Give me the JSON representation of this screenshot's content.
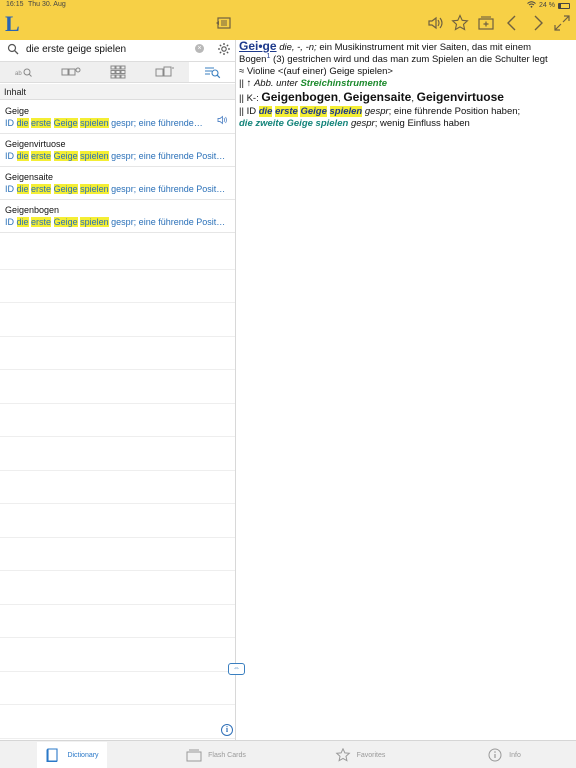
{
  "status": {
    "time": "16:15",
    "date": "Thu 30. Aug",
    "battery": "24 %",
    "battery_level": 0.24
  },
  "app": {
    "logo": "L"
  },
  "toolbar": {
    "icons": [
      "history-icon",
      "speaker-icon",
      "star-icon",
      "add-flashcard-icon",
      "back-icon",
      "forward-icon",
      "fullscreen-icon"
    ]
  },
  "search": {
    "value": "die erste geige spielen",
    "placeholder": ""
  },
  "modes": [
    "fulltext-search-icon",
    "compound-search-icon",
    "grid-icon",
    "wildcard-search-icon",
    "content-search-icon"
  ],
  "section": {
    "title": "Inhalt"
  },
  "results": [
    {
      "title": "Geige",
      "prefix": "ID",
      "hl": [
        "die",
        "erste",
        "Geige",
        "spielen"
      ],
      "rest": "gespr; eine führende…"
    },
    {
      "title": "Geigenvirtuose",
      "prefix": "ID",
      "hl": [
        "die",
        "erste",
        "Geige",
        "spielen"
      ],
      "rest": "gespr; eine führende Posit…"
    },
    {
      "title": "Geigensaite",
      "prefix": "ID",
      "hl": [
        "die",
        "erste",
        "Geige",
        "spielen"
      ],
      "rest": "gespr; eine führende Posit…"
    },
    {
      "title": "Geigenbogen",
      "prefix": "ID",
      "hl": [
        "die",
        "erste",
        "Geige",
        "spielen"
      ],
      "rest": "gespr; eine führende Posit…"
    }
  ],
  "entry": {
    "headword": "Gei•ge",
    "grammar": "die, -, -n;",
    "definition": "ein Musikinstrument mit vier Saiten, das mit einem",
    "def_line2_a": "Bogen",
    "def_sup": "1",
    "def_line2_b": "(3) gestrichen wird und das man zum Spielen an die Schulter legt",
    "syn": "≈ Violine <(auf einer) Geige spielen>",
    "ref_prefix": "|| ↑",
    "ref_abb": "Abb. unter",
    "ref_target": "Streichinstrumente",
    "k_prefix": "|| K-:",
    "compounds": [
      "Geigenbogen",
      "Geigensaite",
      "Geigenvirtuose"
    ],
    "id_prefix": "|| ID",
    "id_phrase": [
      "die",
      "erste",
      "Geige",
      "spielen"
    ],
    "id_label": "gespr",
    "id_meaning": "; eine führende Position haben;",
    "id2_phrase": "die zweite Geige spielen",
    "id2_label": "gespr",
    "id2_meaning": "; wenig Einfluss haben"
  },
  "tabs": [
    {
      "label": "Dictionary",
      "icon": "dictionary-icon",
      "active": true
    },
    {
      "label": "Flash Cards",
      "icon": "flashcards-icon",
      "active": false
    },
    {
      "label": "Favorites",
      "icon": "star-icon",
      "active": false
    },
    {
      "label": "Info",
      "icon": "info-icon",
      "active": false
    }
  ],
  "colors": {
    "accent": "#f7d046",
    "link": "#2a70b8",
    "highlight": "#f4ee34"
  }
}
